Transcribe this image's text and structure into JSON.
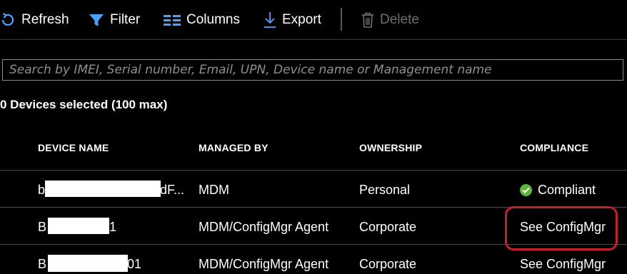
{
  "toolbar": {
    "refresh": "Refresh",
    "filter": "Filter",
    "columns": "Columns",
    "export": "Export",
    "delete": "Delete"
  },
  "search": {
    "placeholder": "Search by IMEI, Serial number, Email, UPN, Device name or Management name",
    "value": ""
  },
  "selection": {
    "summary": "0 Devices selected (100 max)"
  },
  "table": {
    "columns": [
      "DEVICE NAME",
      "MANAGED BY",
      "OWNERSHIP",
      "COMPLIANCE"
    ],
    "rows": [
      {
        "device_name_prefix": "b",
        "device_name_suffix": "dF...",
        "managed_by": "MDM",
        "ownership": "Personal",
        "compliance": "Compliant",
        "compliance_icon": "check-circle-icon"
      },
      {
        "device_name_prefix": "B",
        "device_name_suffix": "1",
        "managed_by": "MDM/ConfigMgr Agent",
        "ownership": "Corporate",
        "compliance": "See ConfigMgr"
      },
      {
        "device_name_prefix": "B",
        "device_name_suffix": "01",
        "managed_by": "MDM/ConfigMgr Agent",
        "ownership": "Corporate",
        "compliance": "See ConfigMgr"
      }
    ]
  },
  "colors": {
    "background": "#000000",
    "text": "#ffffff",
    "accent_icon": "#4aa3ff",
    "disabled": "#6f6f6f",
    "compliant_green": "#5db83a",
    "highlight_red": "#c81e28"
  }
}
